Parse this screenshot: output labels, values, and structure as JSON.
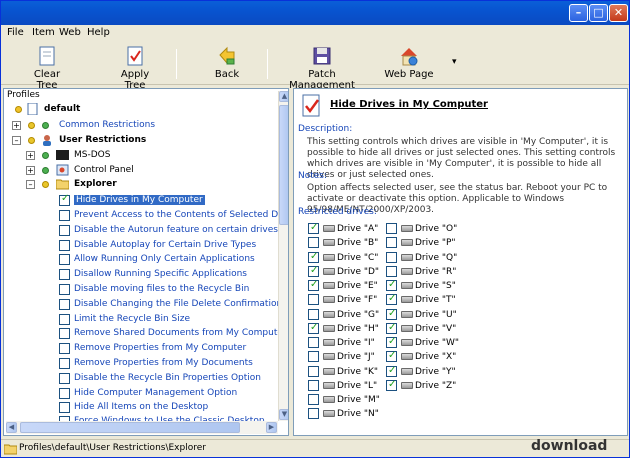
{
  "menu": [
    "File",
    "Item",
    "Web",
    "Help"
  ],
  "toolbar": {
    "clear_tree": "Clear Tree",
    "apply_tree": "Apply Tree",
    "back": "Back",
    "patch_management": "Patch Management",
    "web_page": "Web Page",
    "dropdown_glyph": "▾"
  },
  "tree": {
    "header": "Profiles",
    "rows": [
      {
        "label": "default",
        "bold": true
      },
      {
        "label": "Common Restrictions"
      },
      {
        "label": "User Restrictions",
        "bold": true
      },
      {
        "label": "MS-DOS"
      },
      {
        "label": "Control Panel"
      },
      {
        "label": "Explorer",
        "bold": true
      },
      {
        "label": "Hide Drives in My Computer",
        "checked": true,
        "selected": true
      },
      {
        "label": "Prevent Access to the Contents of Selected Drives"
      },
      {
        "label": "Disable the Autorun feature on certain drives"
      },
      {
        "label": "Disable Autoplay for Certain Drive Types"
      },
      {
        "label": "Allow Running Only Certain Applications"
      },
      {
        "label": "Disallow Running Specific Applications"
      },
      {
        "label": "Disable moving files to the Recycle Bin"
      },
      {
        "label": "Disable Changing the File Delete Confirmation"
      },
      {
        "label": "Limit the Recycle Bin Size"
      },
      {
        "label": "Remove Shared Documents from My Computer"
      },
      {
        "label": "Remove Properties from My Computer"
      },
      {
        "label": "Remove Properties from My Documents"
      },
      {
        "label": "Disable the Recycle Bin Properties Option"
      },
      {
        "label": "Hide Computer Management Option"
      },
      {
        "label": "Hide All Items on the Desktop"
      },
      {
        "label": "Force Windows to Use the Classic Desktop"
      }
    ]
  },
  "detail": {
    "title": "Hide Drives in My Computer",
    "description_label": "Description:",
    "description": "This setting controls which drives are visible in 'My Computer', it is possible to hide all drives or just selected ones. This setting controls which drives are visible in 'My Computer', it is possible to hide all drives or just selected ones.",
    "notes_label": "Notes:",
    "notes": "Option affects selected user, see the status bar. Reboot your PC to activate or deactivate this option. Applicable to Windows 95/98/ME/NT/2000/XP/2003.",
    "drives_label": "Restricted drives:",
    "drives_left": [
      {
        "label": "Drive \"A\"",
        "checked": true
      },
      {
        "label": "Drive \"B\"",
        "checked": false
      },
      {
        "label": "Drive \"C\"",
        "checked": true
      },
      {
        "label": "Drive \"D\"",
        "checked": true
      },
      {
        "label": "Drive \"E\"",
        "checked": true
      },
      {
        "label": "Drive \"F\"",
        "checked": false
      },
      {
        "label": "Drive \"G\"",
        "checked": false
      },
      {
        "label": "Drive \"H\"",
        "checked": true
      },
      {
        "label": "Drive \"I\"",
        "checked": false
      },
      {
        "label": "Drive \"J\"",
        "checked": false
      },
      {
        "label": "Drive \"K\"",
        "checked": false
      },
      {
        "label": "Drive \"L\"",
        "checked": false
      },
      {
        "label": "Drive \"M\"",
        "checked": false
      },
      {
        "label": "Drive \"N\"",
        "checked": false
      }
    ],
    "drives_right": [
      {
        "label": "Drive \"O\"",
        "checked": false
      },
      {
        "label": "Drive \"P\"",
        "checked": false
      },
      {
        "label": "Drive \"Q\"",
        "checked": false
      },
      {
        "label": "Drive \"R\"",
        "checked": false
      },
      {
        "label": "Drive \"S\"",
        "checked": true
      },
      {
        "label": "Drive \"T\"",
        "checked": true
      },
      {
        "label": "Drive \"U\"",
        "checked": true
      },
      {
        "label": "Drive \"V\"",
        "checked": true
      },
      {
        "label": "Drive \"W\"",
        "checked": true
      },
      {
        "label": "Drive \"X\"",
        "checked": true
      },
      {
        "label": "Drive \"Y\"",
        "checked": true
      },
      {
        "label": "Drive \"Z\"",
        "checked": true
      }
    ]
  },
  "status": {
    "path": "Profiles\\default\\User Restrictions\\Explorer",
    "watermark": "download"
  }
}
